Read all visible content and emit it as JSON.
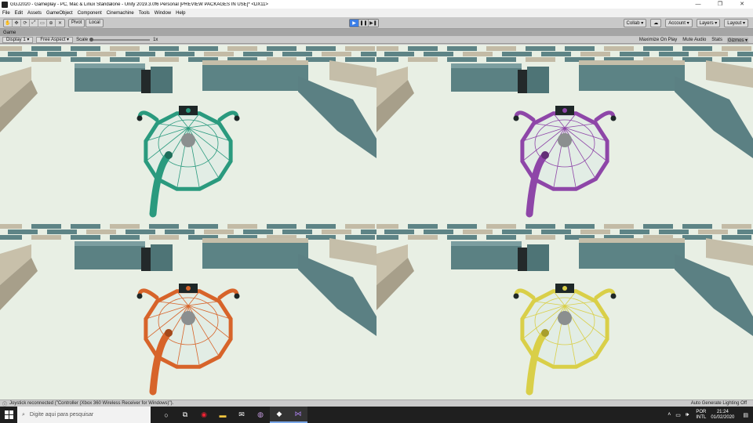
{
  "window": {
    "title": "GGJ2020 - Gameplay - PC, Mac & Linux Standalone - Unity 2019.3.0f6 Personal [PREVIEW PACKAGES IN USE]* <DX11>",
    "controls": [
      "—",
      "❐",
      "✕"
    ]
  },
  "menu": [
    "File",
    "Edit",
    "Assets",
    "GameObject",
    "Component",
    "Cinemachine",
    "Tools",
    "Window",
    "Help"
  ],
  "toolbar": {
    "tools": [
      "✋",
      "✥",
      "⟳",
      "⤢",
      "▭",
      "⊕",
      "✕"
    ],
    "pivot": "Pivot",
    "local": "Local",
    "play": "▶",
    "pause": "❚❚",
    "step": "▶❚",
    "collab": "Collab ▾",
    "cloud": "☁",
    "account": "Account ▾",
    "layers": "Layers ▾",
    "layout": "Layout ▾"
  },
  "game": {
    "tab": "Game",
    "display": "Display 1 ▾",
    "aspect": "Free Aspect ▾",
    "scale_label": "Scale",
    "scale_value": "1x",
    "maximize": "Maximize On Play",
    "mute": "Mute Audio",
    "stats": "Stats",
    "gizmos": "Gizmos ▾"
  },
  "players": [
    {
      "color": "#2a9a7e",
      "dark": "#1d6e5a"
    },
    {
      "color": "#8e46a8",
      "dark": "#632f77"
    },
    {
      "color": "#d7642a",
      "dark": "#a3481a"
    },
    {
      "color": "#d9cf48",
      "dark": "#a89e2c"
    }
  ],
  "status": {
    "message": "Joystick reconnected (\"Controller (Xbox 360 Wireless Receiver for Windows)\").",
    "lighting": "Auto Generate Lighting Off"
  },
  "taskbar": {
    "search_placeholder": "Digite aqui para pesquisar",
    "lang_top": "POR",
    "lang_bottom": "INTL",
    "time": "21:24",
    "date": "01/02/2020"
  }
}
